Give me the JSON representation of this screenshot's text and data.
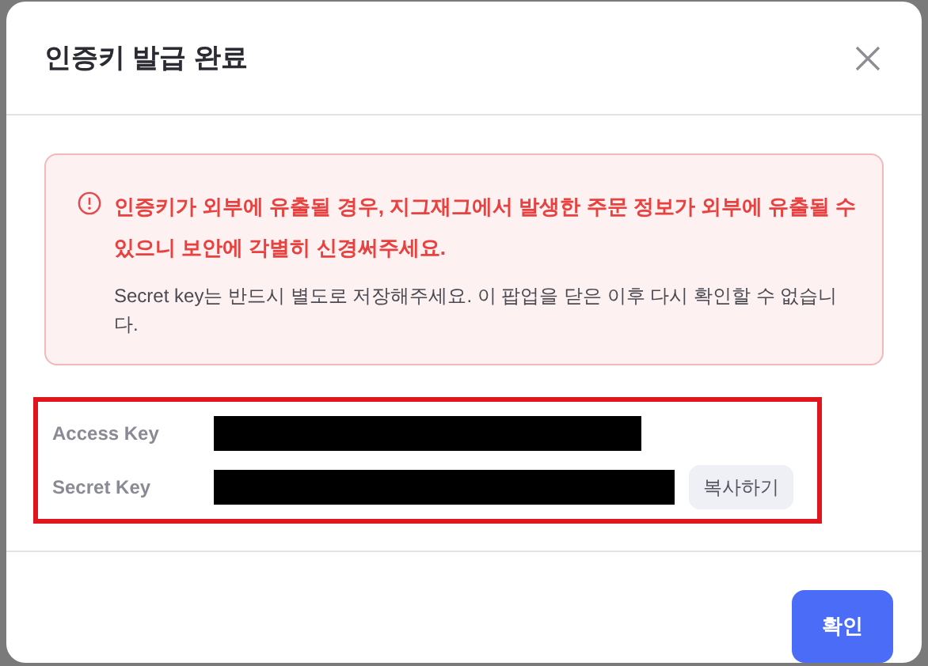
{
  "dialog": {
    "title": "인증키 발급 완료",
    "warning": {
      "headline": "인증키가 외부에 유출될 경우, 지그재그에서 발생한 주문 정보가 외부에 유출될 수 있으니 보안에 각별히 신경써주세요.",
      "note": "Secret key는 반드시 별도로 저장해주세요. 이 팝업을 닫은 이후 다시 확인할 수 없습니다."
    },
    "keys": [
      {
        "label": "Access Key"
      },
      {
        "label": "Secret Key",
        "action": "복사하기"
      }
    ],
    "confirm_button": "확인"
  }
}
